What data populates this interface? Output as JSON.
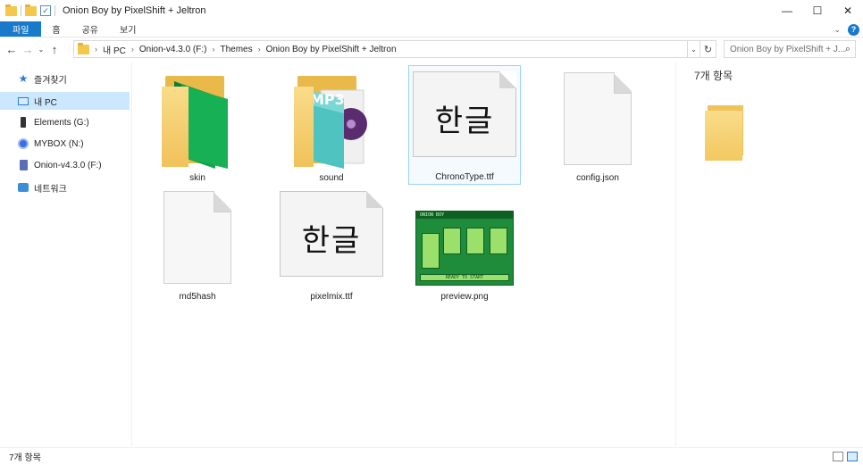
{
  "window": {
    "title": "Onion Boy by PixelShift + Jeltron",
    "minimize": "—",
    "maximize": "☐",
    "close": "✕"
  },
  "ribbon": {
    "tabs": [
      "파일",
      "홈",
      "공유",
      "보기"
    ],
    "collapse_glyph": "⌄",
    "help_glyph": "?"
  },
  "nav": {
    "back": "←",
    "forward": "→",
    "recent": "⌄",
    "up": "↑",
    "breadcrumb": [
      "내 PC",
      "Onion-v4.3.0 (F:)",
      "Themes",
      "Onion Boy by PixelShift + Jeltron"
    ],
    "crumb_sep": "›",
    "dropdown": "⌄",
    "refresh": "↻",
    "search_placeholder": "Onion Boy by PixelShift + J...",
    "search_icon": "⌕"
  },
  "sidebar": {
    "items": [
      {
        "label": "즐겨찾기",
        "icon": "star-icon"
      },
      {
        "label": "내 PC",
        "icon": "pc-icon",
        "active": true
      },
      {
        "label": "Elements (G:)",
        "icon": "drive-icon"
      },
      {
        "label": "MYBOX (N:)",
        "icon": "mybox-icon"
      },
      {
        "label": "Onion-v4.3.0 (F:)",
        "icon": "sdcard-icon"
      },
      {
        "label": "네트워크",
        "icon": "network-icon"
      }
    ]
  },
  "files": [
    {
      "name": "skin",
      "type": "folder"
    },
    {
      "name": "sound",
      "type": "folder-mp3"
    },
    {
      "name": "ChronoType.ttf",
      "type": "font",
      "selected": true
    },
    {
      "name": "config.json",
      "type": "doc"
    },
    {
      "name": "md5hash",
      "type": "doc"
    },
    {
      "name": "pixelmix.ttf",
      "type": "font"
    },
    {
      "name": "preview.png",
      "type": "image"
    }
  ],
  "font_glyph": "한글",
  "mp3_label": "MP3",
  "preview_image": {
    "top_text": "ONION BOY",
    "bottom_text": "READY TO START"
  },
  "preview_pane": {
    "title": "7개 항목"
  },
  "status": {
    "count": "7개 항목"
  }
}
